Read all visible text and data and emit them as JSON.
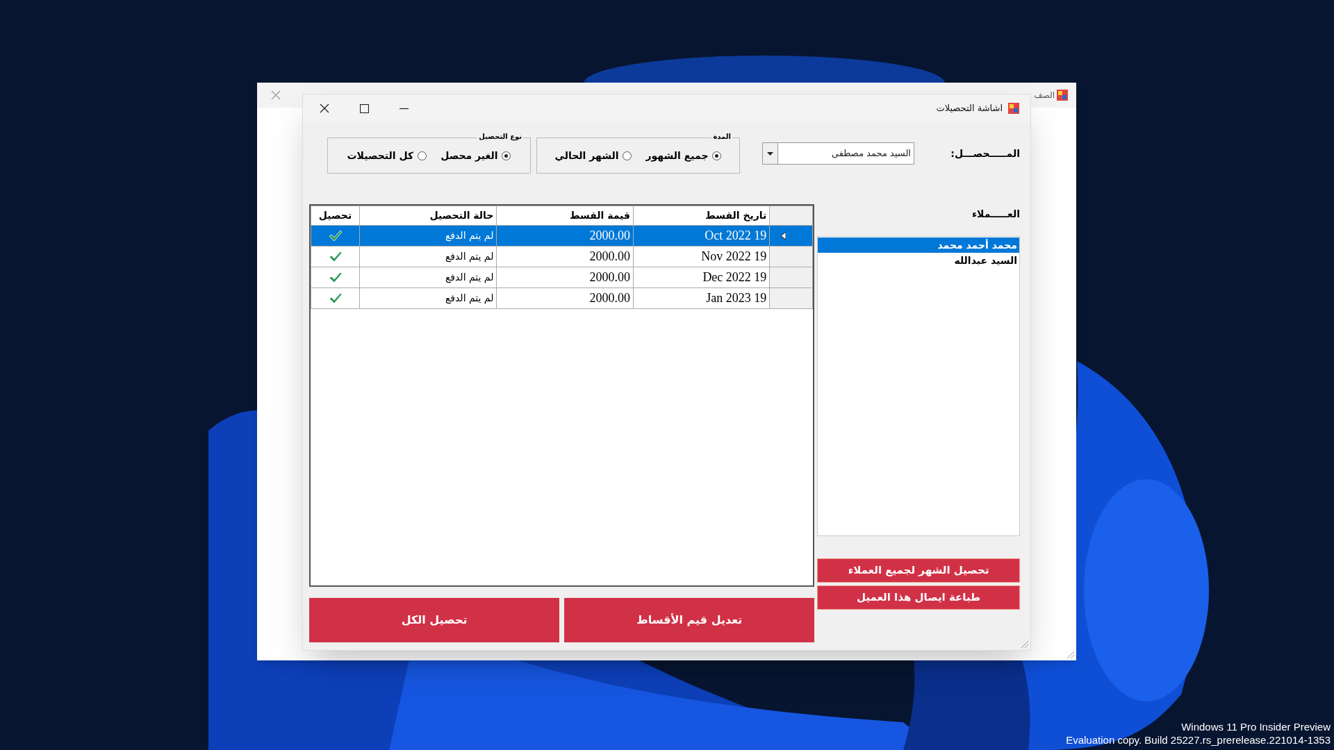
{
  "desktop": {
    "watermark_lines": [
      "Windows 11 Pro Insider Preview",
      "Evaluation copy. Build 25227.rs_prerelease.221014-1353"
    ]
  },
  "back_window": {
    "title": "الصف"
  },
  "window": {
    "title": "اشاشة التحصيلات"
  },
  "collector": {
    "label": "المـــــحصـــل:",
    "value": "السيد محمد مصطفى"
  },
  "period": {
    "title": "المدة",
    "options": [
      {
        "label": "جميع الشهور",
        "selected": true
      },
      {
        "label": "الشهر الحالي",
        "selected": false
      }
    ]
  },
  "collection_type": {
    "title": "نوع التحصيل",
    "options": [
      {
        "label": "الغير محصل",
        "selected": true
      },
      {
        "label": "كل التحصيلات",
        "selected": false
      }
    ]
  },
  "table": {
    "columns": [
      "تاريخ القسط",
      "قيمة القسط",
      "حالة التحصيل",
      "تحصيل"
    ],
    "rows": [
      {
        "date": "Oct 2022 19",
        "amount": "2000.00",
        "status": "لم يتم الدفع",
        "selected": true
      },
      {
        "date": "Nov 2022 19",
        "amount": "2000.00",
        "status": "لم يتم الدفع",
        "selected": false
      },
      {
        "date": "Dec 2022 19",
        "amount": "2000.00",
        "status": "لم يتم الدفع",
        "selected": false
      },
      {
        "date": "Jan 2023 19",
        "amount": "2000.00",
        "status": "لم يتم الدفع",
        "selected": false
      }
    ]
  },
  "customers": {
    "label": "العـــــملاء",
    "items": [
      {
        "name": "محمد أحمد محمد",
        "selected": true
      },
      {
        "name": "السيد عبدالله",
        "selected": false
      }
    ]
  },
  "side_buttons": [
    "تحصيل الشهر لجميع العملاء",
    "طباعة ايصال هذا العميل"
  ],
  "bottom_buttons": [
    "تعديل قيم الأقساط",
    "تحصيل الكل"
  ]
}
